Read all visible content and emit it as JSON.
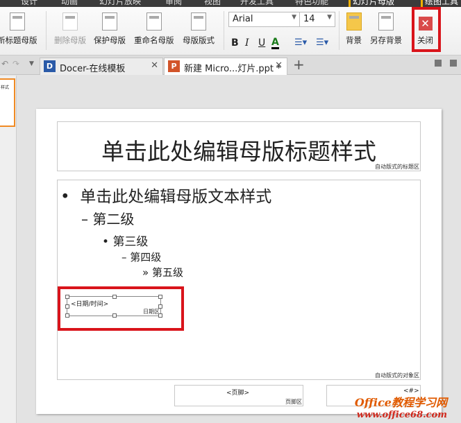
{
  "menu": [
    "设计",
    "动画",
    "幻灯片放映",
    "审阅",
    "视图",
    "开发工具",
    "特色功能",
    "幻灯片母版",
    "绘图工具"
  ],
  "ribbon": {
    "buttons": [
      {
        "label": "新标题母版",
        "enabled": true
      },
      {
        "label": "删除母版",
        "enabled": false
      },
      {
        "label": "保护母版",
        "enabled": true
      },
      {
        "label": "重命名母版",
        "enabled": true
      },
      {
        "label": "母版版式",
        "enabled": true
      }
    ],
    "font": "Arial",
    "size": "14",
    "format": {
      "bold": "B",
      "italic": "I",
      "underline": "U",
      "color": "A"
    },
    "background": "背景",
    "save_background": "另存背景",
    "close": "关闭"
  },
  "tabs": [
    {
      "label": "Docer-在线模板",
      "icon": "D"
    },
    {
      "label": "新建 Micro...灯片.ppt *",
      "icon": "P"
    }
  ],
  "thumb_text": "样式",
  "slide": {
    "title": "单击此处编辑母版标题样式",
    "title_area": "自动版式的标题区",
    "levels": [
      "单击此处编辑母版文本样式",
      "第二级",
      "第三级",
      "第四级",
      "第五级"
    ],
    "bullets": [
      "•",
      "–",
      "•",
      "–",
      "»"
    ],
    "object_area": "自动版式的对象区",
    "date": "<日期/时间>",
    "date_area": "日期区",
    "footer": "<页脚>",
    "footer_area": "页脚区",
    "number": "<#>"
  },
  "watermark": {
    "line1": "Office教程学习网",
    "line2": "www.office68.com"
  },
  "colors": {
    "highlight": "#d9141b",
    "close": "#d94a4a"
  }
}
